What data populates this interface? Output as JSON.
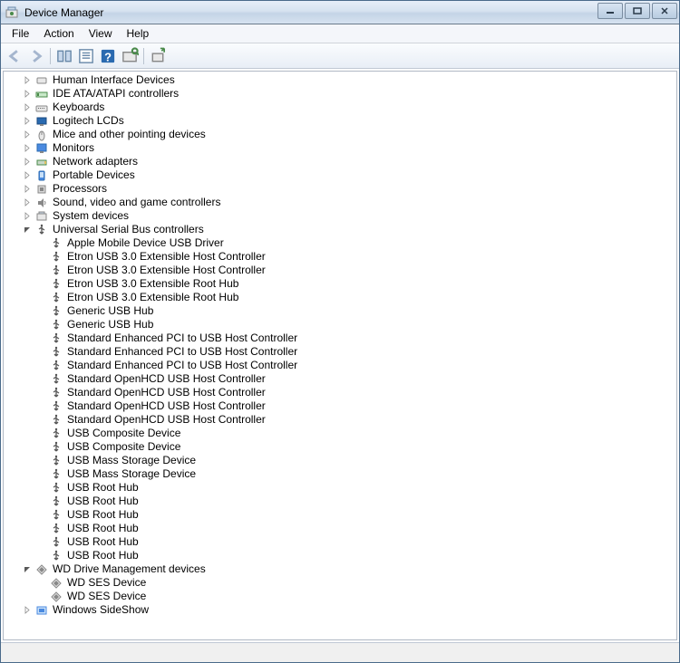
{
  "window": {
    "title": "Device Manager"
  },
  "menubar": [
    "File",
    "Action",
    "View",
    "Help"
  ],
  "tree": [
    {
      "type": "category",
      "expanded": false,
      "icon": "hid",
      "label": "Human Interface Devices"
    },
    {
      "type": "category",
      "expanded": false,
      "icon": "ide",
      "label": "IDE ATA/ATAPI controllers"
    },
    {
      "type": "category",
      "expanded": false,
      "icon": "keyboard",
      "label": "Keyboards"
    },
    {
      "type": "category",
      "expanded": false,
      "icon": "lcd",
      "label": "Logitech LCDs"
    },
    {
      "type": "category",
      "expanded": false,
      "icon": "mouse",
      "label": "Mice and other pointing devices"
    },
    {
      "type": "category",
      "expanded": false,
      "icon": "monitor",
      "label": "Monitors"
    },
    {
      "type": "category",
      "expanded": false,
      "icon": "network",
      "label": "Network adapters"
    },
    {
      "type": "category",
      "expanded": false,
      "icon": "portable",
      "label": "Portable Devices"
    },
    {
      "type": "category",
      "expanded": false,
      "icon": "processor",
      "label": "Processors"
    },
    {
      "type": "category",
      "expanded": false,
      "icon": "sound",
      "label": "Sound, video and game controllers"
    },
    {
      "type": "category",
      "expanded": false,
      "icon": "system",
      "label": "System devices"
    },
    {
      "type": "category",
      "expanded": true,
      "icon": "usb",
      "label": "Universal Serial Bus controllers",
      "children": [
        {
          "icon": "usb-dev",
          "label": "Apple Mobile Device USB Driver"
        },
        {
          "icon": "usb-dev",
          "label": "Etron USB 3.0 Extensible Host Controller"
        },
        {
          "icon": "usb-dev",
          "label": "Etron USB 3.0 Extensible Host Controller"
        },
        {
          "icon": "usb-dev",
          "label": "Etron USB 3.0 Extensible Root Hub"
        },
        {
          "icon": "usb-dev",
          "label": "Etron USB 3.0 Extensible Root Hub"
        },
        {
          "icon": "usb-dev",
          "label": "Generic USB Hub"
        },
        {
          "icon": "usb-dev",
          "label": "Generic USB Hub"
        },
        {
          "icon": "usb-dev",
          "label": "Standard Enhanced PCI to USB Host Controller"
        },
        {
          "icon": "usb-dev",
          "label": "Standard Enhanced PCI to USB Host Controller"
        },
        {
          "icon": "usb-dev",
          "label": "Standard Enhanced PCI to USB Host Controller"
        },
        {
          "icon": "usb-dev",
          "label": "Standard OpenHCD USB Host Controller"
        },
        {
          "icon": "usb-dev",
          "label": "Standard OpenHCD USB Host Controller"
        },
        {
          "icon": "usb-dev",
          "label": "Standard OpenHCD USB Host Controller"
        },
        {
          "icon": "usb-dev",
          "label": "Standard OpenHCD USB Host Controller"
        },
        {
          "icon": "usb-dev",
          "label": "USB Composite Device"
        },
        {
          "icon": "usb-dev",
          "label": "USB Composite Device"
        },
        {
          "icon": "usb-dev",
          "label": "USB Mass Storage Device"
        },
        {
          "icon": "usb-dev",
          "label": "USB Mass Storage Device"
        },
        {
          "icon": "usb-dev",
          "label": "USB Root Hub"
        },
        {
          "icon": "usb-dev",
          "label": "USB Root Hub"
        },
        {
          "icon": "usb-dev",
          "label": "USB Root Hub"
        },
        {
          "icon": "usb-dev",
          "label": "USB Root Hub"
        },
        {
          "icon": "usb-dev",
          "label": "USB Root Hub"
        },
        {
          "icon": "usb-dev",
          "label": "USB Root Hub"
        }
      ]
    },
    {
      "type": "category",
      "expanded": true,
      "icon": "wd",
      "label": "WD Drive Management devices",
      "children": [
        {
          "icon": "wd-dev",
          "label": "WD SES Device"
        },
        {
          "icon": "wd-dev",
          "label": "WD SES Device"
        }
      ]
    },
    {
      "type": "category",
      "expanded": false,
      "icon": "sideshow",
      "label": "Windows SideShow"
    }
  ]
}
